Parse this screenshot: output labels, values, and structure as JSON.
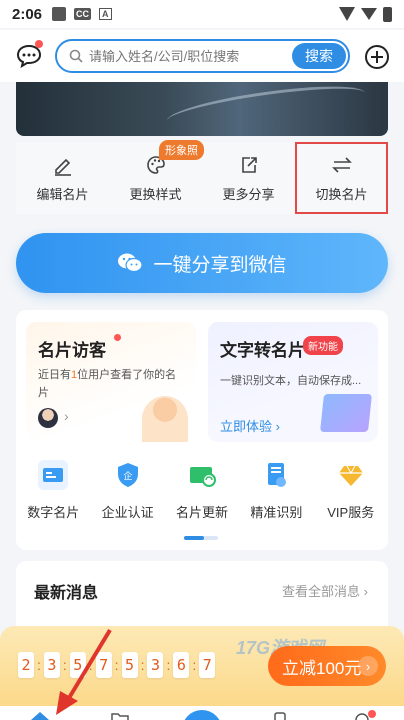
{
  "status": {
    "time": "2:06",
    "cc": "CC",
    "a": "A"
  },
  "search": {
    "placeholder": "请输入姓名/公司/职位搜索",
    "button": "搜索"
  },
  "actions": [
    {
      "label": "编辑名片",
      "icon": "edit-icon"
    },
    {
      "label": "更换样式",
      "icon": "palette-icon",
      "badge": "形象照"
    },
    {
      "label": "更多分享",
      "icon": "share-icon"
    },
    {
      "label": "切换名片",
      "icon": "switch-icon"
    }
  ],
  "share_button": "一键分享到微信",
  "card_visitors": {
    "title": "名片访客",
    "desc_prefix": "近日有",
    "count": "1",
    "desc_suffix": "位用户查看了你的名片"
  },
  "card_text": {
    "title": "文字转名片",
    "badge": "新功能",
    "desc": "一键识别文本，自动保存成...",
    "link": "立即体验 ›"
  },
  "features": [
    {
      "label": "数字名片",
      "icon": "digital-card-icon",
      "color": "#3a9bf2"
    },
    {
      "label": "企业认证",
      "icon": "enterprise-shield-icon",
      "color": "#3a9bf2"
    },
    {
      "label": "名片更新",
      "icon": "card-update-icon",
      "color": "#2fbf6a"
    },
    {
      "label": "精准识别",
      "icon": "scan-icon",
      "color": "#3a9bf2"
    },
    {
      "label": "VIP服务",
      "icon": "vip-diamond-icon",
      "color": "#f5b82e"
    }
  ],
  "news": {
    "title": "最新消息",
    "more": "查看全部消息 ›"
  },
  "promo": {
    "digits": [
      "2",
      "3",
      "5",
      "7",
      "5",
      "3",
      "6",
      "7"
    ],
    "button": "立减100元",
    "watermark": "17G游戏网"
  }
}
